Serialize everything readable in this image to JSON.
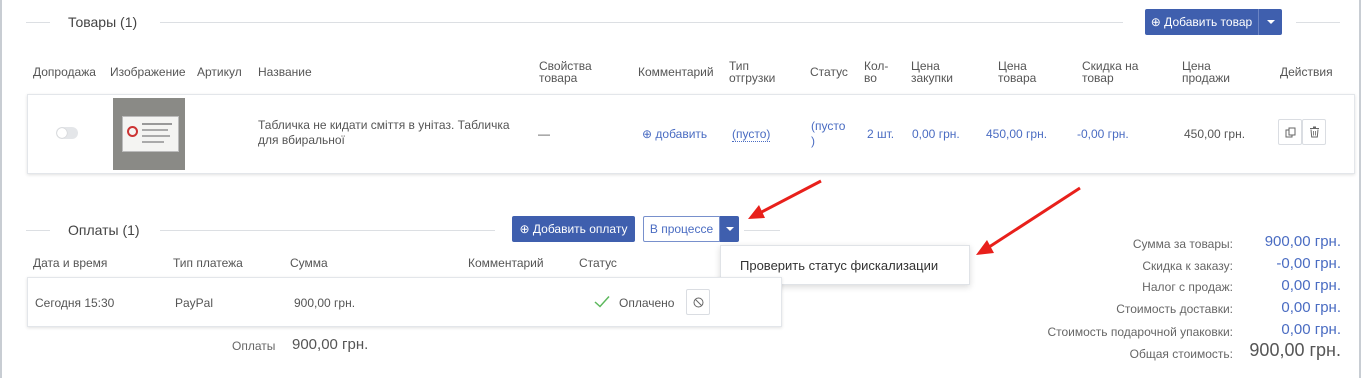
{
  "products": {
    "title": "Товары (1)",
    "add_button": "⊕ Добавить товар",
    "headers": {
      "upsell": "Допродажа",
      "image": "Изображение",
      "sku": "Артикул",
      "name": "Название",
      "props_l1": "Свойства",
      "props_l2": "товара",
      "comment": "Комментарий",
      "ship_l1": "Тип",
      "ship_l2": "отгрузки",
      "status": "Статус",
      "qty_l1": "Кол-",
      "qty_l2": "во",
      "purchase_l1": "Цена",
      "purchase_l2": "закупки",
      "price_l1": "Цена",
      "price_l2": "товара",
      "discount_l1": "Скидка на",
      "discount_l2": "товар",
      "sale_l1": "Цена",
      "sale_l2": "продажи",
      "actions": "Действия"
    },
    "row": {
      "name_l1": "Табличка не кидати сміття в унітаз. Табличка",
      "name_l2": "для вбиральної",
      "props": "—",
      "comment_add": "⊕ добавить",
      "ship": "(пусто)",
      "status_l1": "(пусто",
      "status_l2": ")",
      "qty": "2 шт.",
      "purchase": "0,00 грн.",
      "price": "450,00 грн.",
      "discount": "-0,00 грн.",
      "sale": "450,00 грн."
    }
  },
  "payments": {
    "title": "Оплаты (1)",
    "add_button": "⊕ Добавить оплату",
    "status_button": "В процессе",
    "dropdown_item": "Проверить статус фискализации",
    "headers": {
      "datetime": "Дата и время",
      "type": "Тип платежа",
      "amount": "Сумма",
      "comment": "Комментарий",
      "status": "Статус"
    },
    "row": {
      "datetime": "Сегодня 15:30",
      "type": "PayPal",
      "amount": "900,00 грн.",
      "status": "Оплачено"
    },
    "footer_label": "Оплаты",
    "footer_value": "900,00 грн."
  },
  "summary": [
    {
      "label": "Сумма за товары:",
      "value": "900,00 грн."
    },
    {
      "label": "Скидка к заказу:",
      "value": "-0,00 грн."
    },
    {
      "label": "Налог с продаж:",
      "value": "0,00 грн."
    },
    {
      "label": "Стоимость доставки:",
      "value": "0,00 грн."
    },
    {
      "label": "Стоимость подарочной упаковки:",
      "value": "0,00 грн."
    },
    {
      "label": "Общая стоимость:",
      "value": "900,00 грн."
    }
  ],
  "colors": {
    "primary": "#3f5fae",
    "link": "#4a6cc2",
    "annotation_arrow": "#e8201b",
    "paid_check": "#5cb85c"
  }
}
